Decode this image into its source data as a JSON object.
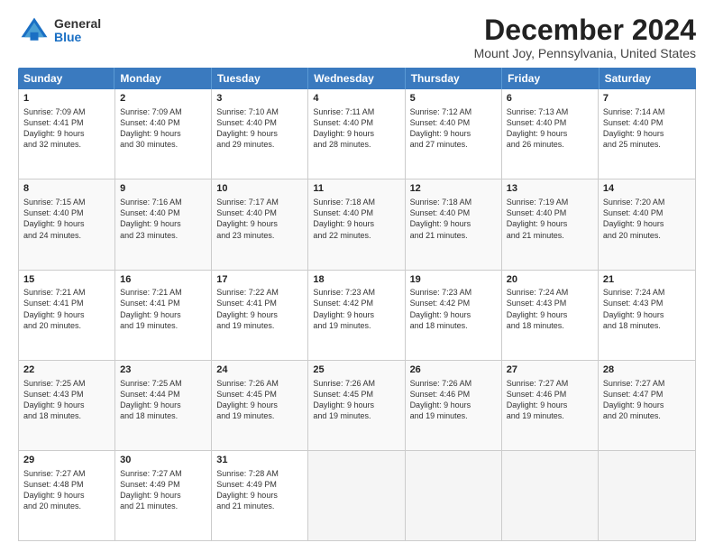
{
  "logo": {
    "general": "General",
    "blue": "Blue"
  },
  "title": "December 2024",
  "subtitle": "Mount Joy, Pennsylvania, United States",
  "header_days": [
    "Sunday",
    "Monday",
    "Tuesday",
    "Wednesday",
    "Thursday",
    "Friday",
    "Saturday"
  ],
  "weeks": [
    [
      {
        "day": "1",
        "lines": [
          "Sunrise: 7:09 AM",
          "Sunset: 4:41 PM",
          "Daylight: 9 hours",
          "and 32 minutes."
        ]
      },
      {
        "day": "2",
        "lines": [
          "Sunrise: 7:09 AM",
          "Sunset: 4:40 PM",
          "Daylight: 9 hours",
          "and 30 minutes."
        ]
      },
      {
        "day": "3",
        "lines": [
          "Sunrise: 7:10 AM",
          "Sunset: 4:40 PM",
          "Daylight: 9 hours",
          "and 29 minutes."
        ]
      },
      {
        "day": "4",
        "lines": [
          "Sunrise: 7:11 AM",
          "Sunset: 4:40 PM",
          "Daylight: 9 hours",
          "and 28 minutes."
        ]
      },
      {
        "day": "5",
        "lines": [
          "Sunrise: 7:12 AM",
          "Sunset: 4:40 PM",
          "Daylight: 9 hours",
          "and 27 minutes."
        ]
      },
      {
        "day": "6",
        "lines": [
          "Sunrise: 7:13 AM",
          "Sunset: 4:40 PM",
          "Daylight: 9 hours",
          "and 26 minutes."
        ]
      },
      {
        "day": "7",
        "lines": [
          "Sunrise: 7:14 AM",
          "Sunset: 4:40 PM",
          "Daylight: 9 hours",
          "and 25 minutes."
        ]
      }
    ],
    [
      {
        "day": "8",
        "lines": [
          "Sunrise: 7:15 AM",
          "Sunset: 4:40 PM",
          "Daylight: 9 hours",
          "and 24 minutes."
        ]
      },
      {
        "day": "9",
        "lines": [
          "Sunrise: 7:16 AM",
          "Sunset: 4:40 PM",
          "Daylight: 9 hours",
          "and 23 minutes."
        ]
      },
      {
        "day": "10",
        "lines": [
          "Sunrise: 7:17 AM",
          "Sunset: 4:40 PM",
          "Daylight: 9 hours",
          "and 23 minutes."
        ]
      },
      {
        "day": "11",
        "lines": [
          "Sunrise: 7:18 AM",
          "Sunset: 4:40 PM",
          "Daylight: 9 hours",
          "and 22 minutes."
        ]
      },
      {
        "day": "12",
        "lines": [
          "Sunrise: 7:18 AM",
          "Sunset: 4:40 PM",
          "Daylight: 9 hours",
          "and 21 minutes."
        ]
      },
      {
        "day": "13",
        "lines": [
          "Sunrise: 7:19 AM",
          "Sunset: 4:40 PM",
          "Daylight: 9 hours",
          "and 21 minutes."
        ]
      },
      {
        "day": "14",
        "lines": [
          "Sunrise: 7:20 AM",
          "Sunset: 4:40 PM",
          "Daylight: 9 hours",
          "and 20 minutes."
        ]
      }
    ],
    [
      {
        "day": "15",
        "lines": [
          "Sunrise: 7:21 AM",
          "Sunset: 4:41 PM",
          "Daylight: 9 hours",
          "and 20 minutes."
        ]
      },
      {
        "day": "16",
        "lines": [
          "Sunrise: 7:21 AM",
          "Sunset: 4:41 PM",
          "Daylight: 9 hours",
          "and 19 minutes."
        ]
      },
      {
        "day": "17",
        "lines": [
          "Sunrise: 7:22 AM",
          "Sunset: 4:41 PM",
          "Daylight: 9 hours",
          "and 19 minutes."
        ]
      },
      {
        "day": "18",
        "lines": [
          "Sunrise: 7:23 AM",
          "Sunset: 4:42 PM",
          "Daylight: 9 hours",
          "and 19 minutes."
        ]
      },
      {
        "day": "19",
        "lines": [
          "Sunrise: 7:23 AM",
          "Sunset: 4:42 PM",
          "Daylight: 9 hours",
          "and 18 minutes."
        ]
      },
      {
        "day": "20",
        "lines": [
          "Sunrise: 7:24 AM",
          "Sunset: 4:43 PM",
          "Daylight: 9 hours",
          "and 18 minutes."
        ]
      },
      {
        "day": "21",
        "lines": [
          "Sunrise: 7:24 AM",
          "Sunset: 4:43 PM",
          "Daylight: 9 hours",
          "and 18 minutes."
        ]
      }
    ],
    [
      {
        "day": "22",
        "lines": [
          "Sunrise: 7:25 AM",
          "Sunset: 4:43 PM",
          "Daylight: 9 hours",
          "and 18 minutes."
        ]
      },
      {
        "day": "23",
        "lines": [
          "Sunrise: 7:25 AM",
          "Sunset: 4:44 PM",
          "Daylight: 9 hours",
          "and 18 minutes."
        ]
      },
      {
        "day": "24",
        "lines": [
          "Sunrise: 7:26 AM",
          "Sunset: 4:45 PM",
          "Daylight: 9 hours",
          "and 19 minutes."
        ]
      },
      {
        "day": "25",
        "lines": [
          "Sunrise: 7:26 AM",
          "Sunset: 4:45 PM",
          "Daylight: 9 hours",
          "and 19 minutes."
        ]
      },
      {
        "day": "26",
        "lines": [
          "Sunrise: 7:26 AM",
          "Sunset: 4:46 PM",
          "Daylight: 9 hours",
          "and 19 minutes."
        ]
      },
      {
        "day": "27",
        "lines": [
          "Sunrise: 7:27 AM",
          "Sunset: 4:46 PM",
          "Daylight: 9 hours",
          "and 19 minutes."
        ]
      },
      {
        "day": "28",
        "lines": [
          "Sunrise: 7:27 AM",
          "Sunset: 4:47 PM",
          "Daylight: 9 hours",
          "and 20 minutes."
        ]
      }
    ],
    [
      {
        "day": "29",
        "lines": [
          "Sunrise: 7:27 AM",
          "Sunset: 4:48 PM",
          "Daylight: 9 hours",
          "and 20 minutes."
        ]
      },
      {
        "day": "30",
        "lines": [
          "Sunrise: 7:27 AM",
          "Sunset: 4:49 PM",
          "Daylight: 9 hours",
          "and 21 minutes."
        ]
      },
      {
        "day": "31",
        "lines": [
          "Sunrise: 7:28 AM",
          "Sunset: 4:49 PM",
          "Daylight: 9 hours",
          "and 21 minutes."
        ]
      },
      {
        "day": "",
        "lines": []
      },
      {
        "day": "",
        "lines": []
      },
      {
        "day": "",
        "lines": []
      },
      {
        "day": "",
        "lines": []
      }
    ]
  ]
}
